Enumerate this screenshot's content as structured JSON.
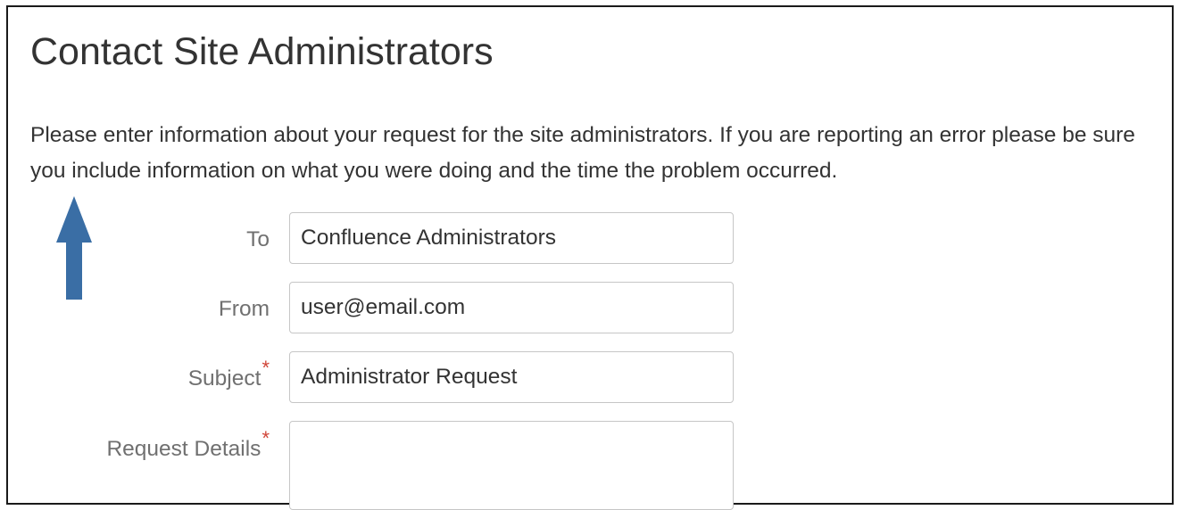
{
  "page": {
    "title": "Contact Site Administrators",
    "intro": "Please enter information about your request for the site administrators. If you are reporting an error please be sure you include information on what you were doing and the time the problem occurred."
  },
  "annotation": {
    "arrow_icon": "up-arrow-icon",
    "color": "#3a6ea5"
  },
  "form": {
    "to": {
      "label": "To",
      "value": "Confluence Administrators"
    },
    "from": {
      "label": "From",
      "value": "user@email.com"
    },
    "subject": {
      "label": "Subject",
      "required_mark": "*",
      "value": "Administrator Request"
    },
    "details": {
      "label": "Request Details",
      "required_mark": "*",
      "value": ""
    }
  },
  "colors": {
    "label": "#707070",
    "text": "#333333",
    "required": "#d04437",
    "field_border": "#c6c6c6"
  }
}
